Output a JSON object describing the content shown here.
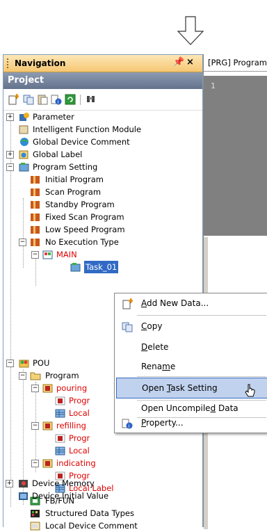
{
  "nav": {
    "title": "Navigation",
    "pin": "1",
    "close": "×",
    "project": "Project"
  },
  "program_tab": {
    "title": "[PRG] Program",
    "line_number": "1"
  },
  "tree": {
    "parameter": "Parameter",
    "intelligent": "Intelligent Function Module",
    "global_device_comment": "Global Device Comment",
    "global_label": "Global Label",
    "program_setting": "Program Setting",
    "initial_program": "Initial Program",
    "scan_program": "Scan Program",
    "standby_program": "Standby Program",
    "fixed_scan_program": "Fixed Scan Program",
    "low_speed_program": "Low Speed Program",
    "no_execution_type": "No Execution Type",
    "main": "MAIN",
    "task": "Task_01",
    "pou": "POU",
    "program": "Program",
    "pouring": "pouring",
    "pouring_prog": "Progr",
    "pouring_local": "Local",
    "refilling": "refilling",
    "refilling_prog": "Progr",
    "refilling_local": "Local",
    "indicating": "indicating",
    "indicating_prog": "Progr",
    "indicating_local": "Local Label",
    "fb_fun": "FB/FUN",
    "structured": "Structured Data Types",
    "local_device_comment": "Local Device Comment",
    "device_memory": "Device Memory",
    "device_initial_value": "Device Initial Value"
  },
  "context_menu": {
    "add_new_data": "Add New Data...",
    "copy": "Copy",
    "delete": "Delete",
    "rename": "Rename",
    "open_task_setting": "Open Task Setting",
    "open_uncompiled_data": "Open Uncompiled Data",
    "property": "Property..."
  },
  "colors": {
    "nav_header": "#f6c774",
    "project_bar": "#64738c",
    "selection": "#316ac5",
    "menu_highlight": "#c1d2ee",
    "red_text": "#e00000"
  }
}
